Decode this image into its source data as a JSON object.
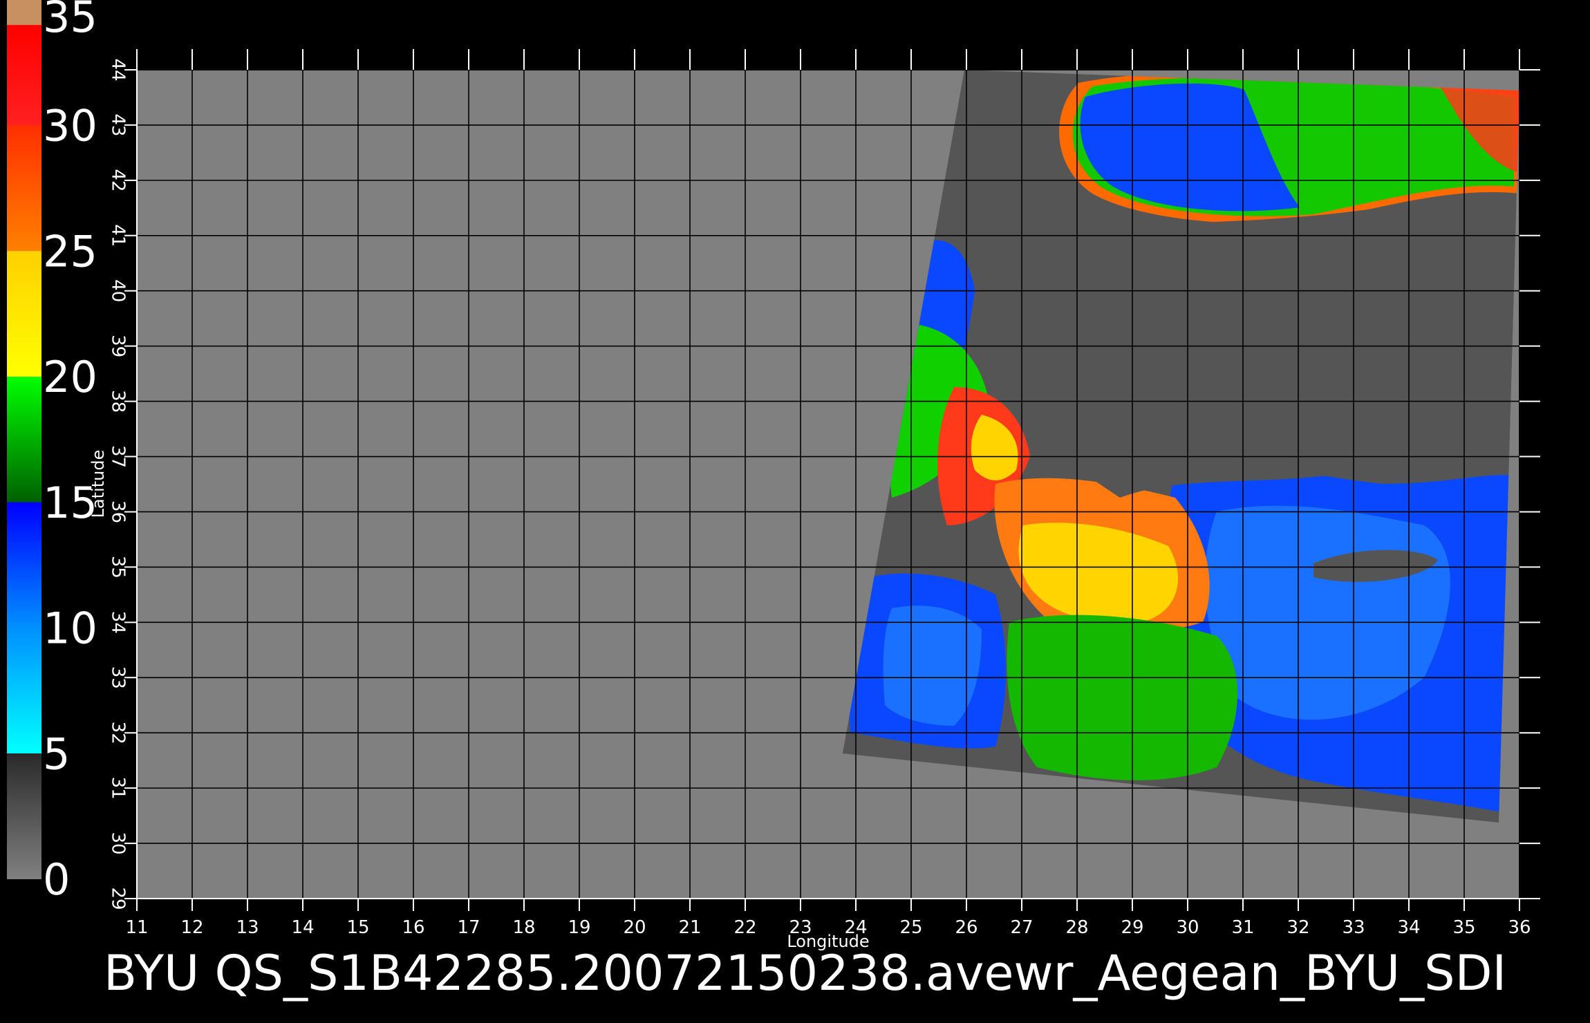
{
  "chart_data": {
    "type": "heatmap",
    "title": "BYU  QS_S1B42285.20072150238.avewr_Aegean_BYU_SDI",
    "xlabel": "Longitude",
    "ylabel": "Latitude",
    "xlim": [
      11,
      36
    ],
    "ylim": [
      29,
      44
    ],
    "x_ticks": [
      "11",
      "12",
      "13",
      "14",
      "15",
      "16",
      "17",
      "18",
      "19",
      "20",
      "21",
      "22",
      "23",
      "24",
      "25",
      "26",
      "27",
      "28",
      "29",
      "30",
      "31",
      "32",
      "33",
      "34",
      "35",
      "36"
    ],
    "y_ticks": [
      "29",
      "30",
      "31",
      "32",
      "33",
      "34",
      "35",
      "36",
      "37",
      "38",
      "39",
      "40",
      "41",
      "42",
      "43",
      "44"
    ],
    "grid": true,
    "colorbar": {
      "range": [
        0,
        35
      ],
      "labels": [
        "0",
        "5",
        "10",
        "15",
        "20",
        "25",
        "30",
        "35"
      ],
      "stops": [
        {
          "value": 0,
          "color": "#808080"
        },
        {
          "value": 5,
          "color": "#2a2a2a"
        },
        {
          "value": 5.01,
          "color": "#00ffff"
        },
        {
          "value": 10,
          "color": "#0090ff"
        },
        {
          "value": 15,
          "color": "#0000ff"
        },
        {
          "value": 15.01,
          "color": "#006000"
        },
        {
          "value": 20,
          "color": "#00ff00"
        },
        {
          "value": 20.01,
          "color": "#ffff00"
        },
        {
          "value": 25,
          "color": "#ffd000"
        },
        {
          "value": 25.01,
          "color": "#ff8000"
        },
        {
          "value": 30,
          "color": "#ff3000"
        },
        {
          "value": 30.01,
          "color": "#ff2020"
        },
        {
          "value": 34,
          "color": "#ff0000"
        },
        {
          "value": 34.01,
          "color": "#c89060"
        },
        {
          "value": 35,
          "color": "#c89060"
        }
      ]
    },
    "colors": {
      "background": "#000000",
      "plot_area": "#808080",
      "swath": "#555555",
      "grid": "#000000"
    }
  }
}
